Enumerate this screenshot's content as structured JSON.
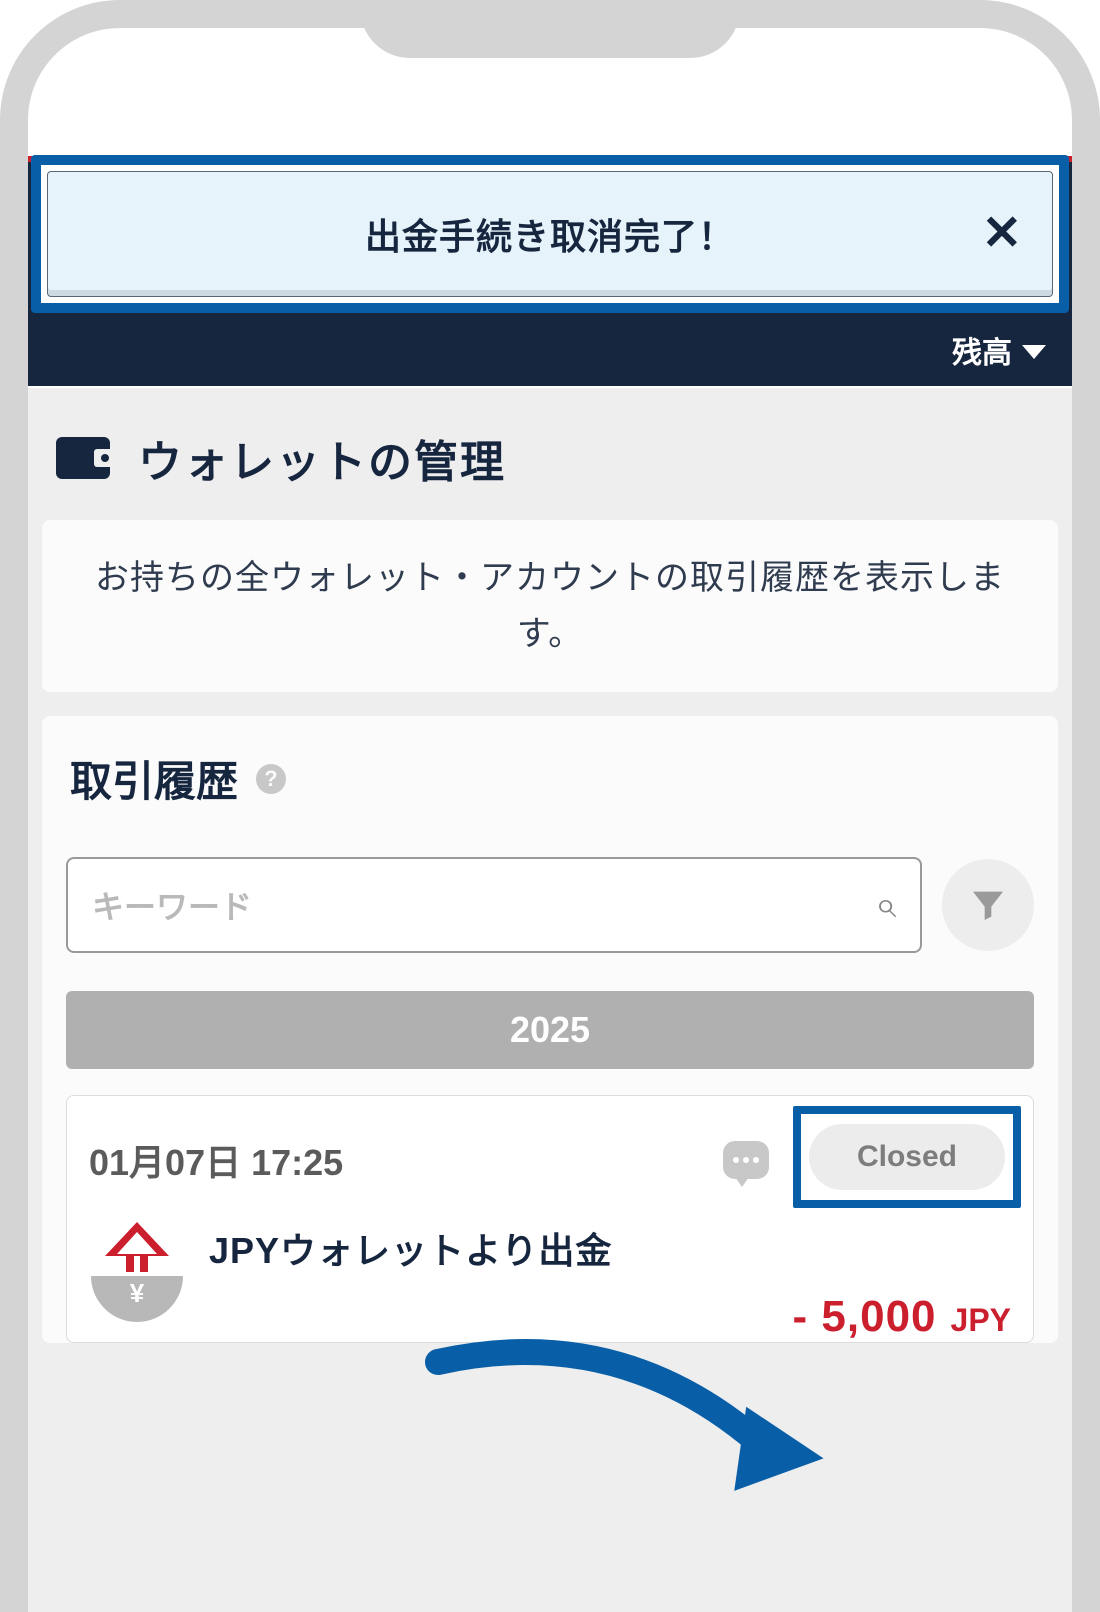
{
  "nav": {
    "balance_label": "残高"
  },
  "notification": {
    "message": "出金手続き取消完了！"
  },
  "page": {
    "title": "ウォレットの管理",
    "description": "お持ちの全ウォレット・アカウントの取引履歴を表示します。"
  },
  "history": {
    "title": "取引履歴",
    "search_placeholder": "キーワード",
    "year": "2025"
  },
  "transaction": {
    "date": "01月07日 17:25",
    "status": "Closed",
    "label": "JPYウォレットより出金",
    "amount": "- 5,000",
    "currency": "JPY",
    "yen_symbol": "¥"
  }
}
